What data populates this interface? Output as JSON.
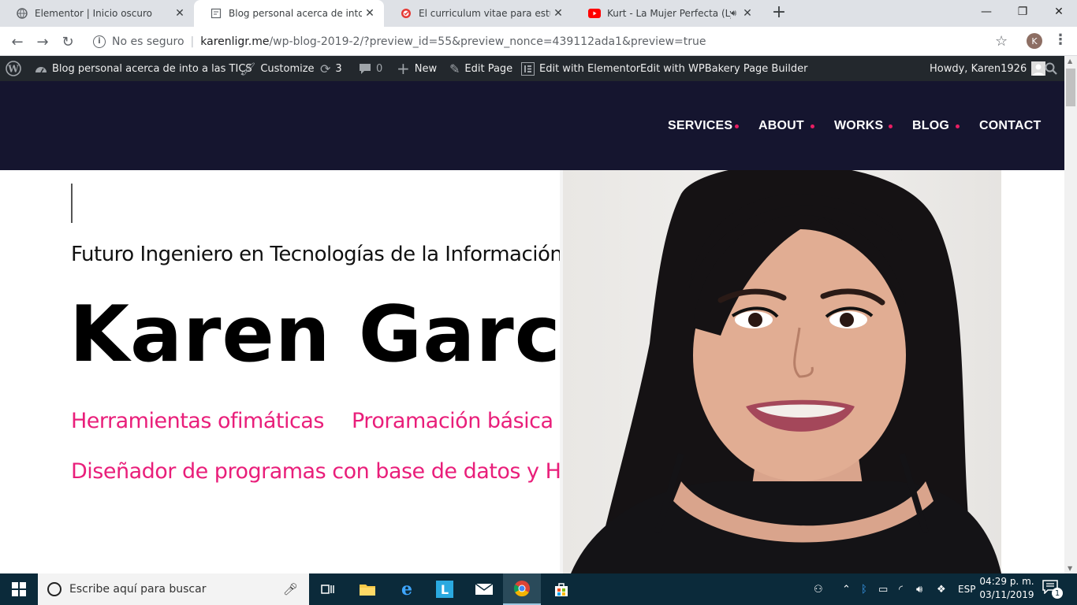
{
  "browser": {
    "tabs": [
      {
        "title": "Elementor | Inicio oscuro",
        "icon": "globe-icon",
        "active": false
      },
      {
        "title": "Blog personal acerca de into a las TICS",
        "icon": "page-icon",
        "active": true
      },
      {
        "title": "El curriculum vitae para estudiantes",
        "icon": "target-icon",
        "active": false
      },
      {
        "title": "Kurt - La Mujer Perfecta (Lyrics)",
        "icon": "youtube-icon",
        "active": false
      }
    ],
    "new_tab": "+",
    "close_glyph": "✕",
    "security_label": "No es seguro",
    "url_host": "karenligr.me",
    "url_path": "/wp-blog-2019-2/?preview_id=55&preview_nonce=439112ada1&preview=true",
    "profile_initial": "K"
  },
  "adminbar": {
    "site_name": "Blog personal acerca de into a las TICS",
    "customize": "Customize",
    "updates_count": "3",
    "comments_count": "0",
    "new": "New",
    "edit_page": "Edit Page",
    "edit_elementor": "Edit with Elementor",
    "edit_wpbakery": "Edit with WPBakery Page Builder",
    "howdy": "Howdy, Karen1926"
  },
  "site": {
    "nav": [
      "SERVICES",
      "ABOUT",
      "WORKS",
      "BLOG",
      "CONTACT"
    ],
    "accent_color": "#e91e63",
    "header_bg": "#15152f"
  },
  "hero": {
    "subtitle": "Futuro Ingeniero en Tecnologías de la Información",
    "name": "Karen Garcia",
    "skills": [
      "Herramientas ofimáticas",
      "Proramación básica",
      "Diseñador de programas con base de datos y HTML"
    ],
    "skill_color": "#e91e7a"
  },
  "taskbar": {
    "search_placeholder": "Escribe aquí para buscar",
    "language": "ESP",
    "time": "04:29 p. m.",
    "date": "03/11/2019",
    "notification_count": "1"
  }
}
